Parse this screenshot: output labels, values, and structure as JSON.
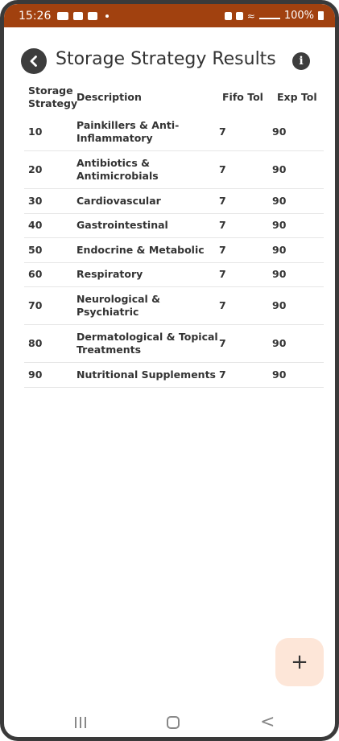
{
  "status_bar": {
    "time": "15:26",
    "battery": "100%",
    "network": "Vo) LTE1",
    "left_icons": [
      "youtube-icon",
      "gallery-icon",
      "bag-icon",
      "dot-icon"
    ],
    "right_icons": [
      "lock-icon",
      "alarm-icon",
      "wifi-icon",
      "signal-icon",
      "battery-icon"
    ],
    "color": "#a1410f"
  },
  "header": {
    "title": "Storage Strategy Results",
    "back_icon": "chevron-left-icon",
    "info_icon": "info-icon",
    "info_glyph": "i"
  },
  "table": {
    "columns": [
      "Storage Strategy",
      "Description",
      "Fifo Tol",
      "Exp Tol"
    ],
    "rows": [
      {
        "strategy": "10",
        "description": "Painkillers & Anti-Inflammatory",
        "fifo_tol": "7",
        "exp_tol": "90"
      },
      {
        "strategy": "20",
        "description": "Antibiotics & Antimicrobials",
        "fifo_tol": "7",
        "exp_tol": "90"
      },
      {
        "strategy": "30",
        "description": "Cardiovascular",
        "fifo_tol": "7",
        "exp_tol": "90"
      },
      {
        "strategy": "40",
        "description": "Gastrointestinal",
        "fifo_tol": "7",
        "exp_tol": "90"
      },
      {
        "strategy": "50",
        "description": "Endocrine & Metabolic",
        "fifo_tol": "7",
        "exp_tol": "90"
      },
      {
        "strategy": "60",
        "description": "Respiratory",
        "fifo_tol": "7",
        "exp_tol": "90"
      },
      {
        "strategy": "70",
        "description": "Neurological & Psychiatric",
        "fifo_tol": "7",
        "exp_tol": "90"
      },
      {
        "strategy": "80",
        "description": "Dermatological & Topical Treatments",
        "fifo_tol": "7",
        "exp_tol": "90"
      },
      {
        "strategy": "90",
        "description": "Nutritional Supplements",
        "fifo_tol": "7",
        "exp_tol": "90"
      }
    ]
  },
  "fab": {
    "label": "+",
    "icon": "plus-icon",
    "color": "#fde6d8"
  },
  "nav": {
    "icons": [
      "recents-icon",
      "home-icon",
      "back-icon"
    ],
    "back_glyph": "<"
  }
}
